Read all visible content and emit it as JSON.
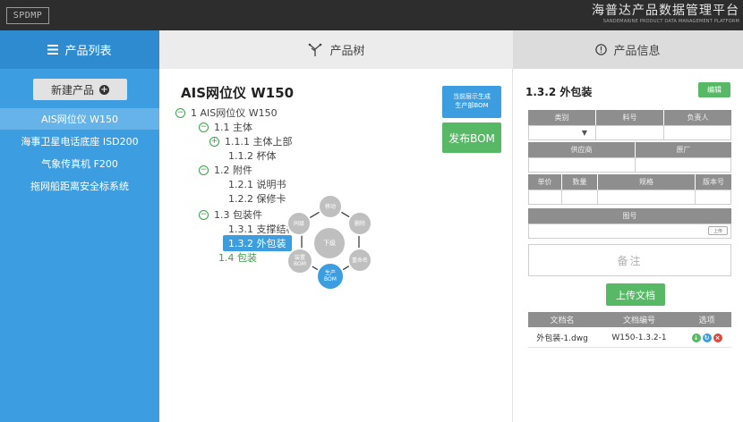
{
  "app": {
    "logo": "SPDMP",
    "brand_cn": "海普达产品数据管理平台",
    "brand_en": "SANDEMARINE PRODUCT DATA MANAGEMENT PLATFORM"
  },
  "headers": {
    "list": "产品列表",
    "tree": "产品树",
    "info": "产品信息"
  },
  "sidebar": {
    "new_product": "新建产品",
    "items": [
      {
        "label": "AIS网位仪 W150",
        "active": true
      },
      {
        "label": "海事卫星电话底座 ISD200",
        "active": false
      },
      {
        "label": "气象传真机 F200",
        "active": false
      },
      {
        "label": "拖网船距离安全标系统",
        "active": false
      }
    ]
  },
  "tree": {
    "title": "AIS网位仪 W150",
    "nodes": [
      {
        "toggle": "−",
        "label": "1  AIS网位仪 W150"
      },
      {
        "toggle": "−",
        "label": "1.1  主体"
      },
      {
        "toggle": "+",
        "label": "1.1.1  主体上部"
      },
      {
        "toggle": "",
        "label": "1.1.2  杯体"
      },
      {
        "toggle": "−",
        "label": "1.2  附件"
      },
      {
        "toggle": "",
        "label": "1.2.1  说明书"
      },
      {
        "toggle": "",
        "label": "1.2.2  保修卡"
      },
      {
        "toggle": "−",
        "label": "1.3  包装件"
      },
      {
        "toggle": "",
        "label": "1.3.1  支撑结构"
      },
      {
        "toggle": "",
        "label": "1.3.2  外包装"
      },
      {
        "toggle": "",
        "label": "1.4  包装"
      }
    ],
    "btn_generate": "当前层示生成\n生产部BOM",
    "btn_publish": "发布BOM",
    "radial": {
      "center": "下级",
      "items": [
        "移动",
        "删除",
        "重命名",
        "生产\nBOM",
        "装置\nBOM",
        "同级"
      ]
    }
  },
  "info": {
    "section_title": "1.3.2 外包装",
    "edit": "编辑",
    "row1_headers": [
      "类别",
      "料号",
      "负责人"
    ],
    "row2_headers": [
      "供应商",
      "原厂"
    ],
    "row3_headers": [
      "单价",
      "数量",
      "规格",
      "版本号"
    ],
    "row4_header": "图号",
    "upload_small": "上传",
    "note": "备注",
    "upload_doc": "上传文档",
    "docs_headers": [
      "文档名",
      "文档编号",
      "选项"
    ],
    "docs": [
      {
        "name": "外包装-1.dwg",
        "code": "W150-1.3.2-1"
      }
    ]
  },
  "colors": {
    "topbar": "#2d2d2d",
    "blue": "#3c9ee0",
    "green": "#57b865"
  }
}
